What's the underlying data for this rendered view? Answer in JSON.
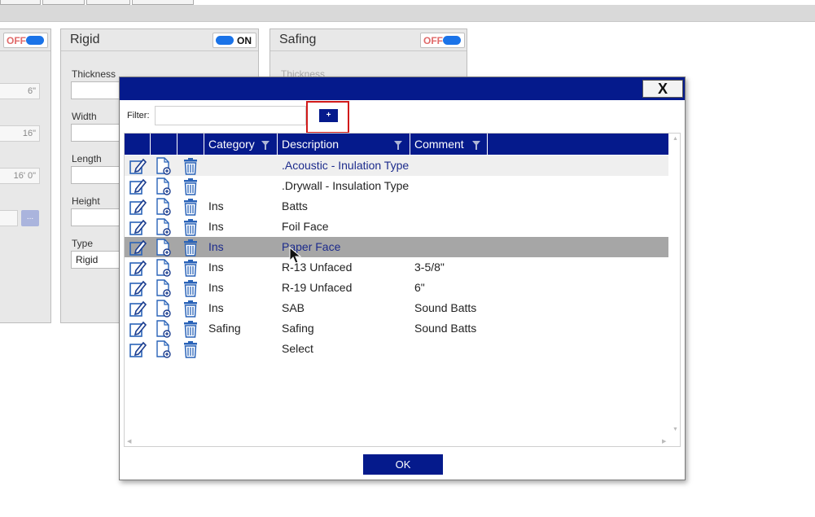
{
  "colors": {
    "accent": "#051a8c",
    "highlight": "#d11a1a",
    "toggle_on": "#1a73e8"
  },
  "left_panel": {
    "toggle_text": "OFF",
    "values": [
      "6\"",
      "16\"",
      "16' 0\""
    ],
    "button_label": "..."
  },
  "rigid_panel": {
    "title": "Rigid",
    "toggle_text": "ON",
    "fields": {
      "thickness": "Thickness",
      "width": "Width",
      "length": "Length",
      "height": "Height",
      "type": "Type"
    },
    "type_value": "Rigid"
  },
  "safing_panel": {
    "title": "Safing",
    "toggle_text": "OFF",
    "thickness_label": "Thickness"
  },
  "dialog": {
    "close_label": "X",
    "filter_label": "Filter:",
    "filter_value": "",
    "add_label": "+",
    "ok_label": "OK",
    "columns": [
      "Category",
      "Description",
      "Comment"
    ],
    "icons": {
      "edit": "edit-icon",
      "copy": "copy-document-icon",
      "delete": "trash-icon"
    },
    "rows": [
      {
        "category": "",
        "description": ".Acoustic - Inulation Type",
        "comment": ""
      },
      {
        "category": "",
        "description": ".Drywall - Insulation Type",
        "comment": ""
      },
      {
        "category": "Ins",
        "description": "Batts",
        "comment": ""
      },
      {
        "category": "Ins",
        "description": "Foil Face",
        "comment": ""
      },
      {
        "category": "Ins",
        "description": "Paper Face",
        "comment": ""
      },
      {
        "category": "Ins",
        "description": "R-13 Unfaced",
        "comment": "3-5/8\""
      },
      {
        "category": "Ins",
        "description": "R-19 Unfaced",
        "comment": "6\""
      },
      {
        "category": "Ins",
        "description": "SAB",
        "comment": "Sound Batts"
      },
      {
        "category": "Safing",
        "description": "Safing",
        "comment": "Sound Batts"
      },
      {
        "category": "",
        "description": "Select",
        "comment": ""
      }
    ]
  }
}
